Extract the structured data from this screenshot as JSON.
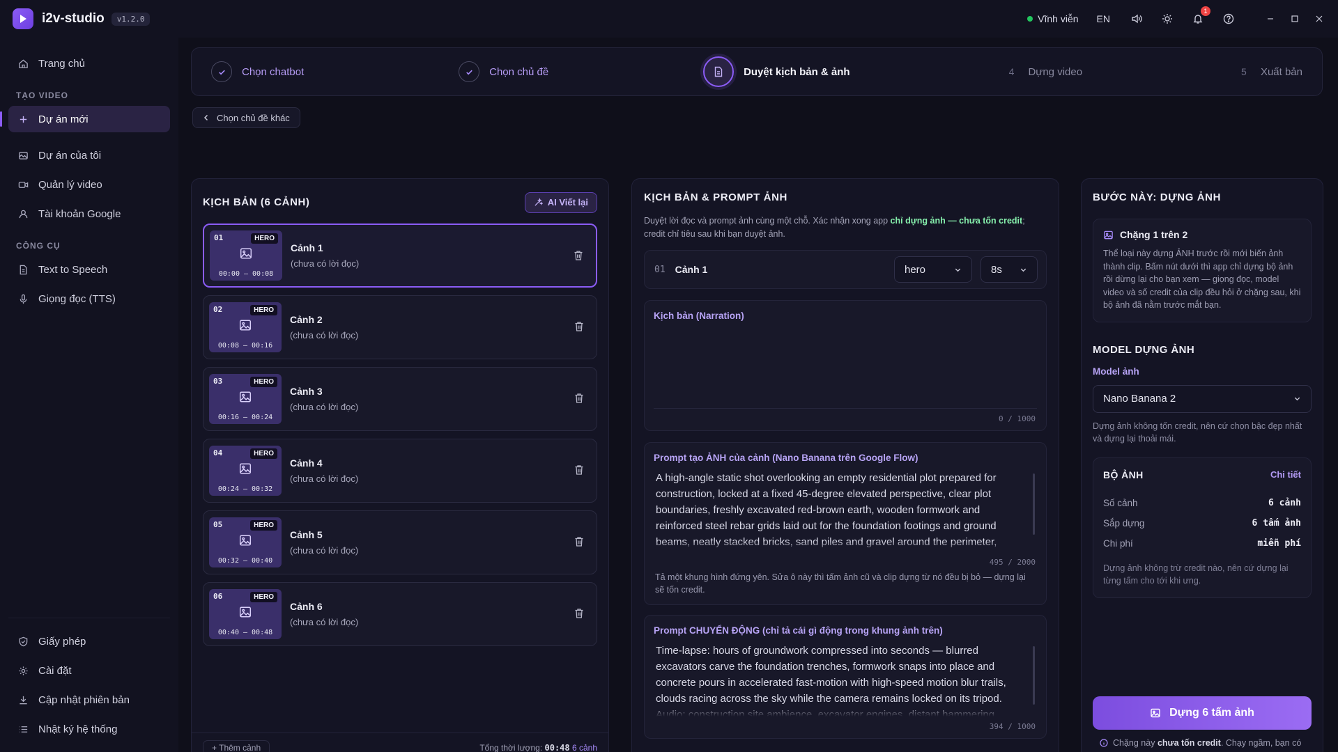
{
  "app": {
    "name": "i2v-studio",
    "version": "v1.2.0"
  },
  "titlebar": {
    "license": "Vĩnh viễn",
    "lang": "EN",
    "notif_count": "1"
  },
  "sidebar": {
    "home": "Trang chủ",
    "section_create": "TẠO VIDEO",
    "new_project": "Dự án mới",
    "my_projects": "Dự án của tôi",
    "video_manager": "Quản lý video",
    "google_account": "Tài khoản Google",
    "section_tools": "CÔNG CỤ",
    "tts": "Text to Speech",
    "voices": "Giọng đọc (TTS)",
    "license": "Giấy phép",
    "settings": "Cài đặt",
    "update": "Cập nhật phiên bản",
    "syslog": "Nhật ký hệ thống"
  },
  "stepper": {
    "steps": [
      {
        "label": "Chọn chatbot",
        "state": "done"
      },
      {
        "label": "Chọn chủ đề",
        "state": "done"
      },
      {
        "label": "Duyệt kịch bản & ảnh",
        "state": "current"
      },
      {
        "num": "4",
        "label": "Dựng video",
        "state": "pending"
      },
      {
        "num": "5",
        "label": "Xuất bản",
        "state": "pending"
      }
    ]
  },
  "back_label": "Chọn chủ đề khác",
  "left": {
    "title": "KỊCH BẢN (6 CẢNH)",
    "ai_rewrite": "AI Viết lại",
    "badge": "HERO",
    "subtitle": "(chưa có lời đọc)",
    "scenes": [
      {
        "num": "01",
        "name": "Cảnh 1",
        "time": "00:00 – 00:08"
      },
      {
        "num": "02",
        "name": "Cảnh 2",
        "time": "00:08 – 00:16"
      },
      {
        "num": "03",
        "name": "Cảnh 3",
        "time": "00:16 – 00:24"
      },
      {
        "num": "04",
        "name": "Cảnh 4",
        "time": "00:24 – 00:32"
      },
      {
        "num": "05",
        "name": "Cảnh 5",
        "time": "00:32 – 00:40"
      },
      {
        "num": "06",
        "name": "Cảnh 6",
        "time": "00:40 – 00:48"
      }
    ],
    "add_scene": "+ Thêm cảnh",
    "total_label": "Tổng thời lượng:",
    "total_time": "00:48",
    "total_scenes": "6 cảnh"
  },
  "middle": {
    "title": "KỊCH BẢN & PROMPT ẢNH",
    "desc_part1": "Duyệt lời đọc và prompt ảnh cùng một chỗ. Xác nhận xong app ",
    "desc_highlight": "chỉ dựng ảnh — chưa tốn credit",
    "desc_part2": "; credit chỉ tiêu sau khi bạn duyệt ảnh.",
    "scene_num": "01",
    "scene_name": "Cảnh 1",
    "shot_type": "hero",
    "duration": "8s",
    "narration_label": "Kịch bản (Narration)",
    "narration_count": "0 / 1000",
    "image_prompt_label": "Prompt tạo ẢNH của cảnh (Nano Banana trên Google Flow)",
    "image_prompt": "A high-angle static shot overlooking an empty residential plot prepared for construction, locked at a fixed 45-degree elevated perspective, clear plot boundaries, freshly excavated red-brown earth, wooden formwork and reinforced steel rebar grids laid out for the foundation footings and ground beams, neatly stacked bricks, sand piles and gravel around the perimeter, bright natural daylight, clear sky and surrounding houses in the background.",
    "image_prompt_count": "495 / 2000",
    "image_prompt_note": "Tả một khung hình đứng yên. Sửa ô này thì tấm ảnh cũ và clip dựng từ nó đều bị bỏ — dựng lại sẽ tốn credit.",
    "motion_prompt_label": "Prompt CHUYỂN ĐỘNG (chỉ tả cái gì động trong khung ảnh trên)",
    "motion_prompt": "Time-lapse: hours of groundwork compressed into seconds — blurred excavators carve the foundation trenches, formwork snaps into place and concrete pours in accelerated fast-motion with high-speed motion blur trails, clouds racing across the sky while the camera remains locked on its tripod. Audio: construction site ambience, excavator engines, distant hammering.",
    "motion_prompt_count": "394 / 1000"
  },
  "right": {
    "title": "BƯỚC NÀY: DỰNG ẢNH",
    "stage_title": "Chặng 1 trên 2",
    "stage_desc": "Thể loại này dựng ẢNH trước rồi mới biến ảnh thành clip. Bấm nút dưới thì app chỉ dựng bộ ảnh rồi dừng lại cho bạn xem — giọng đọc, model video và số credit của clip đều hỏi ở chặng sau, khi bộ ảnh đã nằm trước mắt bạn.",
    "model_section": "MODEL DỰNG ẢNH",
    "model_label": "Model ảnh",
    "model_value": "Nano Banana 2",
    "model_note": "Dựng ảnh không tốn credit, nên cứ chọn bậc đẹp nhất và dựng lại thoải mái.",
    "bo_title": "BỘ ẢNH",
    "bo_link": "Chi tiết",
    "rows": [
      {
        "k": "Số cảnh",
        "v": "6 cảnh"
      },
      {
        "k": "Sắp dựng",
        "v": "6 tấm ảnh"
      },
      {
        "k": "Chi phí",
        "v": "miễn phí"
      }
    ],
    "bo_note": "Dựng ảnh không trừ credit nào, nên cứ dựng lại từng tấm cho tới khi ưng.",
    "render_btn": "Dựng 6 tấm ảnh",
    "foot_pre": "Chặng này ",
    "foot_bold": "chưa tốn credit",
    "foot_post": ". Chạy ngầm, bạn có"
  },
  "colors": {
    "accent": "#8b5cf6",
    "success": "#22c55e",
    "bg": "#0f0f1a"
  }
}
